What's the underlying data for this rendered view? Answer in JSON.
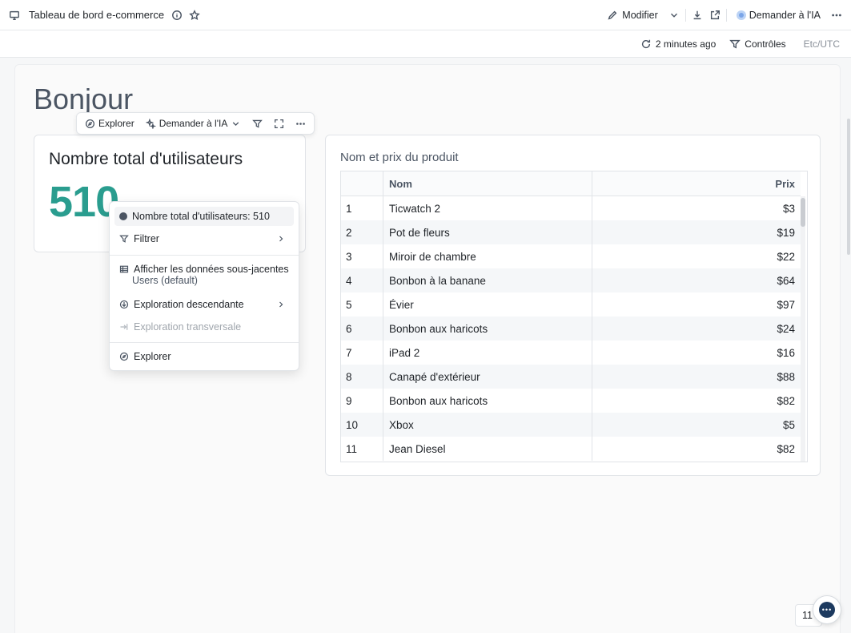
{
  "header": {
    "title": "Tableau de bord e-commerce",
    "edit_label": "Modifier",
    "ask_ai_label": "Demander à l'IA"
  },
  "subheader": {
    "refresh_label": "2 minutes ago",
    "controls_label": "Contrôles",
    "timezone": "Etc/UTC"
  },
  "dashboard": {
    "greeting": "Bonjour"
  },
  "kpi": {
    "title": "Nombre total d'utilisateurs",
    "value": "510"
  },
  "card_toolbar": {
    "explore_label": "Explorer",
    "ask_ai_label": "Demander à l'IA"
  },
  "context_menu": {
    "value_label": "Nombre total d'utilisateurs: 510",
    "filter_label": "Filtrer",
    "underlying_label": "Afficher les données sous-jacentes",
    "underlying_sub": "Users (default)",
    "drill_down_label": "Exploration descendante",
    "drill_across_label": "Exploration transversale",
    "explore_label": "Explorer"
  },
  "table": {
    "title": "Nom et prix du produit",
    "columns": [
      "",
      "Nom",
      "Prix"
    ],
    "rows": [
      {
        "idx": "1",
        "name": "Ticwatch 2",
        "price": "$3"
      },
      {
        "idx": "2",
        "name": "Pot de fleurs",
        "price": "$19"
      },
      {
        "idx": "3",
        "name": "Miroir de chambre",
        "price": "$22"
      },
      {
        "idx": "4",
        "name": "Bonbon à la banane",
        "price": "$64"
      },
      {
        "idx": "5",
        "name": "Évier",
        "price": "$97"
      },
      {
        "idx": "6",
        "name": "Bonbon aux haricots",
        "price": "$24"
      },
      {
        "idx": "7",
        "name": "iPad 2",
        "price": "$16"
      },
      {
        "idx": "8",
        "name": "Canapé d'extérieur",
        "price": "$88"
      },
      {
        "idx": "9",
        "name": "Bonbon aux haricots",
        "price": "$82"
      },
      {
        "idx": "10",
        "name": "Xbox",
        "price": "$5"
      },
      {
        "idx": "11",
        "name": "Jean Diesel",
        "price": "$82"
      }
    ]
  },
  "footer": {
    "page_indicator": "11"
  },
  "colors": {
    "kpi_value": "#2a9d8f",
    "chat_bubble": "#1d3a5f"
  }
}
